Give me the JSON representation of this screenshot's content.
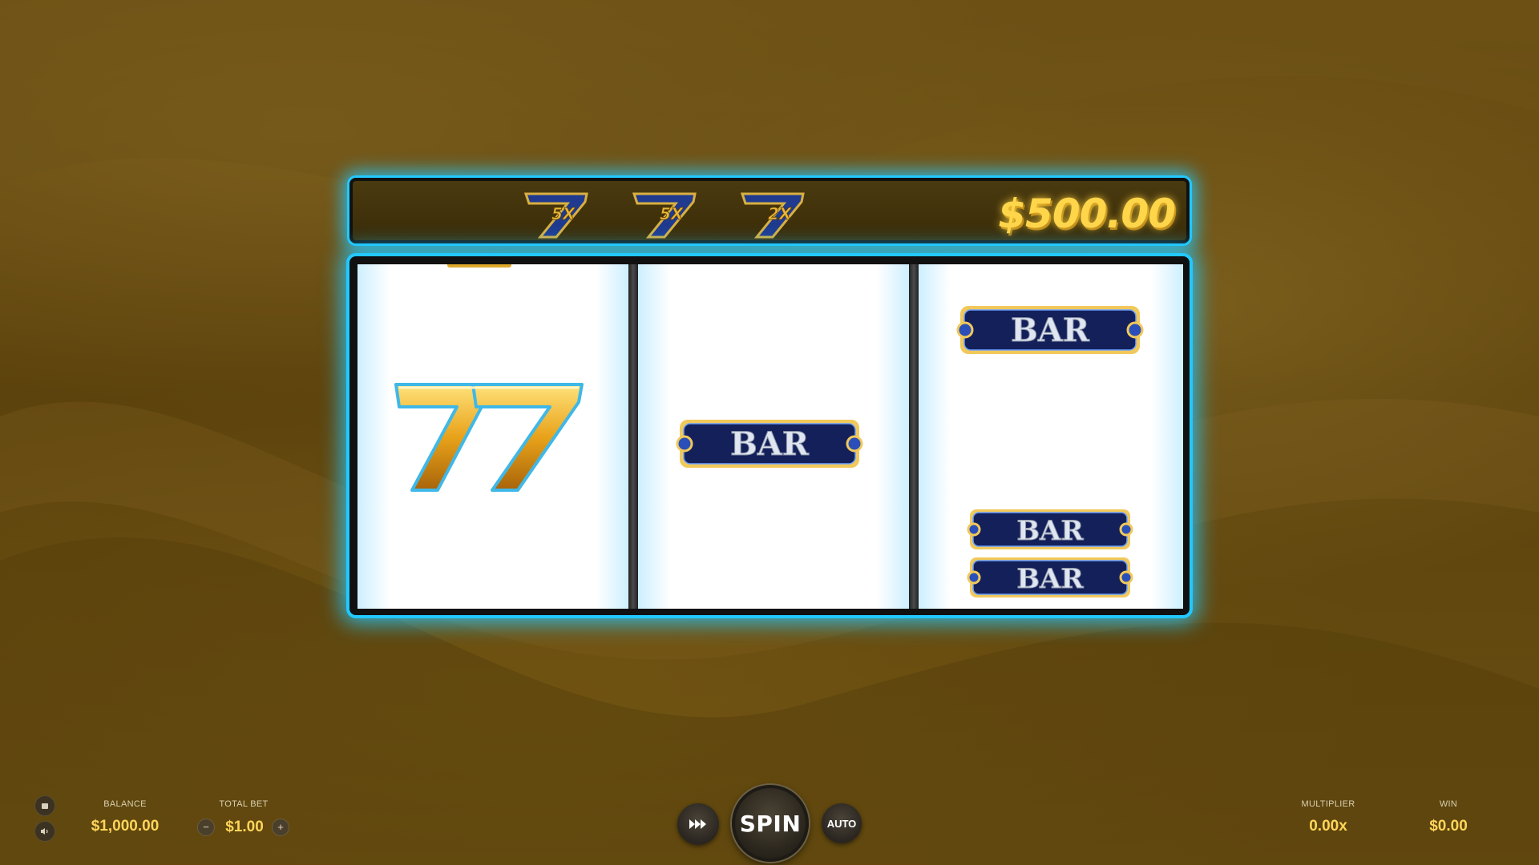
{
  "top_panel": {
    "multipliers": [
      "5X",
      "5X",
      "2X"
    ],
    "jackpot": "$500.00"
  },
  "reels": {
    "reel_1": [
      "seven-seven"
    ],
    "reel_2": [
      "BAR"
    ],
    "reel_3": [
      "BAR",
      "BAR",
      "BAR"
    ]
  },
  "symbol_text": {
    "bar": "BAR",
    "seven": "77"
  },
  "bottom": {
    "balance_label": "BALANCE",
    "balance_value": "$1,000.00",
    "total_bet_label": "TOTAL BET",
    "total_bet_value": "$1.00",
    "minus": "−",
    "plus": "+",
    "turbo_icon": "fast-forward-icon",
    "spin_label": "SPIN",
    "auto_label": "AUTO",
    "multiplier_label": "MULTIPLIER",
    "multiplier_value": "0.00x",
    "win_label": "WIN",
    "win_value": "$0.00"
  },
  "colors": {
    "glow": "#22c8ff",
    "gold": "#ffd55a",
    "bar_navy": "#14205a"
  }
}
